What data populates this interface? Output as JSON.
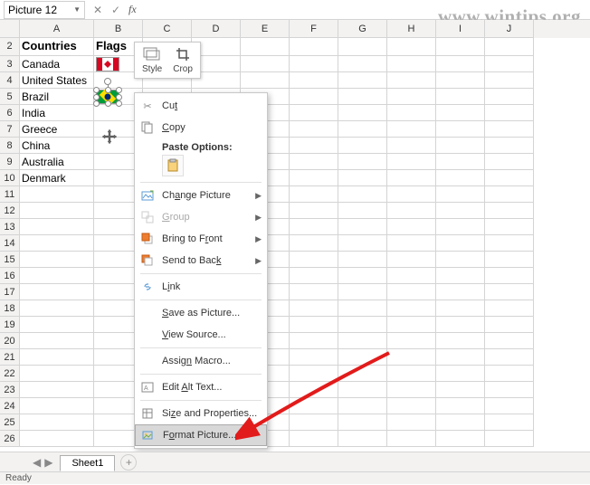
{
  "namebox": {
    "value": "Picture 12"
  },
  "watermark": "www.wintips.org",
  "columns": [
    "A",
    "B",
    "C",
    "D",
    "E",
    "F",
    "G",
    "H",
    "I",
    "J"
  ],
  "rows_shown": 26,
  "headers": {
    "A": "Countries",
    "B": "Flags"
  },
  "data_rows": [
    {
      "num": 3,
      "A": "Canada"
    },
    {
      "num": 4,
      "A": "United States"
    },
    {
      "num": 5,
      "A": "Brazil"
    },
    {
      "num": 6,
      "A": "India"
    },
    {
      "num": 7,
      "A": "Greece"
    },
    {
      "num": 8,
      "A": "China"
    },
    {
      "num": 9,
      "A": "Australia"
    },
    {
      "num": 10,
      "A": "Denmark"
    }
  ],
  "mini_toolbar": {
    "style": "Style",
    "crop": "Crop"
  },
  "context_menu": {
    "cut": "Cut",
    "copy": "Copy",
    "paste_section": "Paste Options:",
    "change_picture": "Change Picture",
    "group": "Group",
    "bring_front": "Bring to Front",
    "send_back": "Send to Back",
    "link": "Link",
    "save_as_picture": "Save as Picture...",
    "view_source": "View Source...",
    "assign_macro": "Assign Macro...",
    "edit_alt": "Edit Alt Text...",
    "size_props": "Size and Properties...",
    "format_picture": "Format Picture..."
  },
  "tabs": {
    "sheet1": "Sheet1"
  },
  "status": "Ready"
}
